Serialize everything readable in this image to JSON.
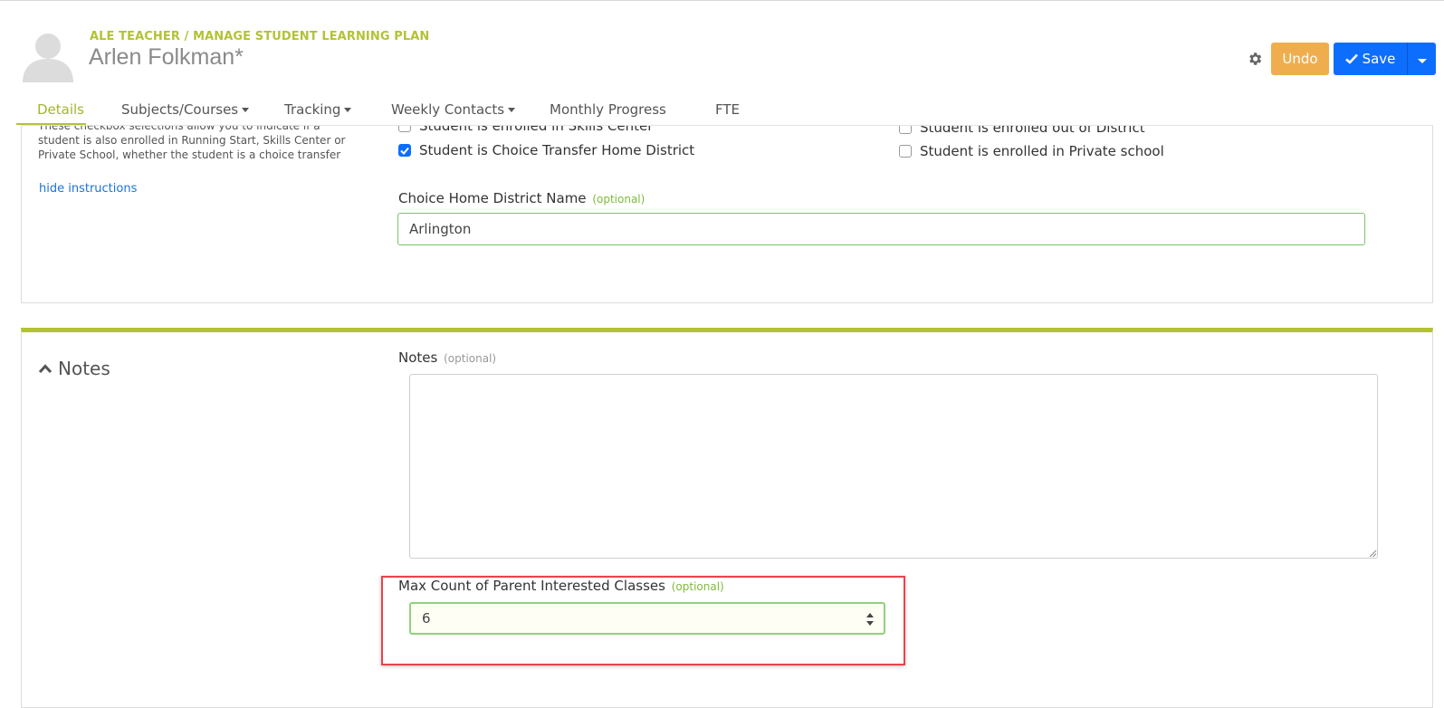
{
  "header": {
    "breadcrumb": "ALE TEACHER / MANAGE STUDENT LEARNING PLAN",
    "student_name": "Arlen Folkman*",
    "undo_label": "Undo",
    "save_label": "Save"
  },
  "tabs": [
    {
      "label": "Details",
      "active": true
    },
    {
      "label": "Subjects/Courses",
      "dropdown": true
    },
    {
      "label": "Tracking",
      "dropdown": true
    },
    {
      "label": "Weekly Contacts",
      "dropdown": true
    },
    {
      "label": "Monthly Progress"
    },
    {
      "label": "FTE"
    }
  ],
  "enrollment": {
    "instructions": "These checkbox selections allow you to indicate if a student is also enrolled in Running Start, Skills Center or Private School, whether the student is a choice transfer",
    "hide_instructions": "hide instructions",
    "checkboxes": {
      "skills_center": {
        "label": "Student is enrolled in Skills Center",
        "checked": false
      },
      "choice_transfer": {
        "label": "Student is Choice Transfer Home District",
        "checked": true
      },
      "out_of_district": {
        "label": "Student is enrolled out of District",
        "checked": false
      },
      "private_school": {
        "label": "Student is enrolled in Private school",
        "checked": false
      }
    },
    "home_district_label": "Choice Home District Name",
    "optional": "(optional)",
    "home_district_value": "Arlington"
  },
  "notes": {
    "heading": "Notes",
    "notes_label": "Notes",
    "notes_value": "",
    "max_count_label": "Max Count of Parent Interested Classes",
    "optional": "(optional)",
    "max_count_value": "6"
  },
  "colors": {
    "accent": "#b3c234",
    "primary": "#0d6efd",
    "warning": "#f0ad4e",
    "highlight": "#e8434b",
    "optional_text": "#7fba3a"
  }
}
